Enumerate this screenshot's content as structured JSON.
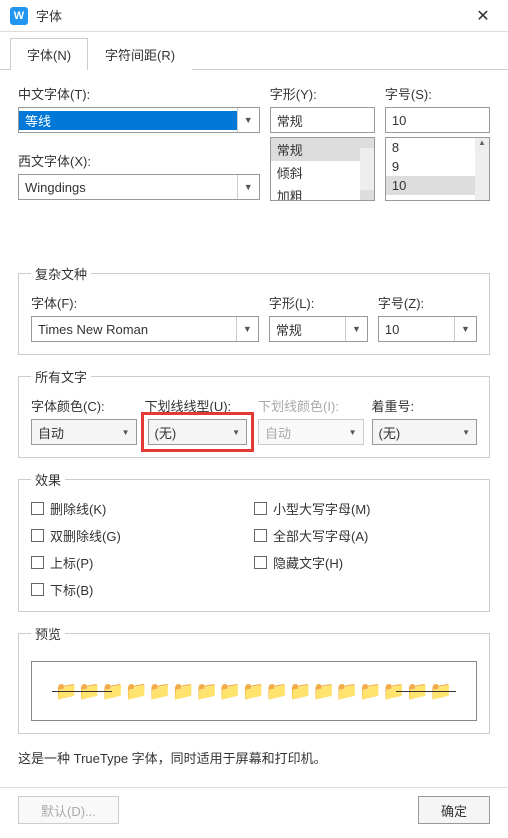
{
  "title": "字体",
  "tabs": {
    "font": "字体(N)",
    "spacing": "字符间距(R)"
  },
  "chinese_font": {
    "label": "中文字体(T):",
    "value": "等线"
  },
  "style": {
    "label": "字形(Y):",
    "value": "常规",
    "options": [
      "常规",
      "倾斜",
      "加粗"
    ]
  },
  "size": {
    "label": "字号(S):",
    "value": "10",
    "options": [
      "8",
      "9",
      "10"
    ]
  },
  "western_font": {
    "label": "西文字体(X):",
    "value": "Wingdings"
  },
  "complex": {
    "legend": "复杂文种",
    "font": {
      "label": "字体(F):",
      "value": "Times New Roman"
    },
    "style": {
      "label": "字形(L):",
      "value": "常规"
    },
    "size": {
      "label": "字号(Z):",
      "value": "10"
    }
  },
  "all_text": {
    "legend": "所有文字",
    "color": {
      "label": "字体颜色(C):",
      "value": "自动"
    },
    "underline": {
      "label": "下划线线型(U):",
      "value": "(无)"
    },
    "underline_color": {
      "label": "下划线颜色(I):",
      "value": "自动"
    },
    "emphasis": {
      "label": "着重号:",
      "value": "(无)"
    }
  },
  "effects": {
    "legend": "效果",
    "strike": "删除线(K)",
    "dbl_strike": "双删除线(G)",
    "sup": "上标(P)",
    "sub": "下标(B)",
    "smallcaps": "小型大写字母(M)",
    "allcaps": "全部大写字母(A)",
    "hidden": "隐藏文字(H)"
  },
  "preview": {
    "legend": "预览",
    "sample": "📁📁📁📁📁📁📁📁📁📁📁📁📁📁📁📁📁"
  },
  "desc": "这是一种 TrueType 字体，同时适用于屏幕和打印机。",
  "footer": {
    "default": "默认(D)...",
    "ok": "确定"
  }
}
